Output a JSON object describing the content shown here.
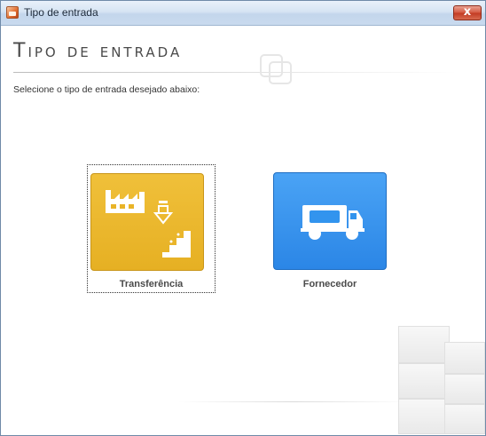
{
  "window": {
    "title": "Tipo de entrada",
    "close_label": "x"
  },
  "page": {
    "heading": "Tipo de entrada",
    "subtitle": "Selecione o tipo de entrada desejado abaixo:"
  },
  "options": [
    {
      "label": "Transferência",
      "color": "#e9b428",
      "icon": "factory-transfer-icon"
    },
    {
      "label": "Fornecedor",
      "color": "#3294ee",
      "icon": "truck-icon"
    }
  ],
  "colors": {
    "titlebar": "#d6e4f3",
    "close": "#c94a34",
    "heading": "#4a4a4a"
  }
}
